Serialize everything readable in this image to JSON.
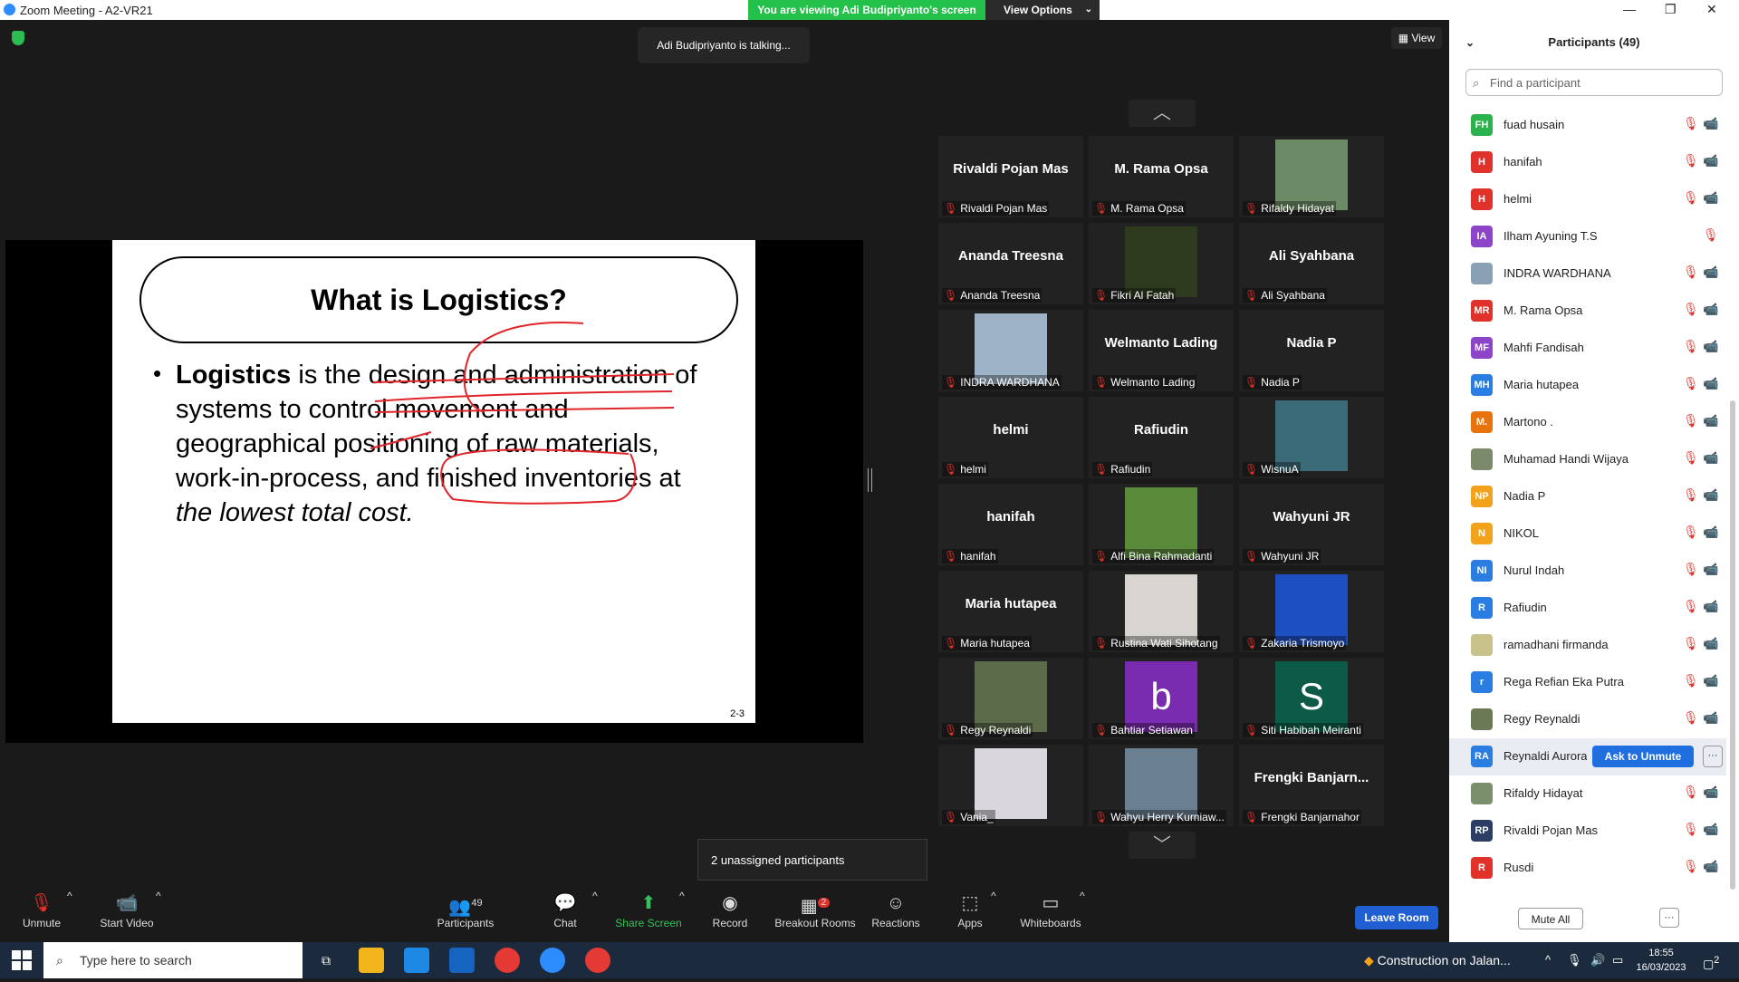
{
  "window": {
    "title": "Zoom Meeting - A2-VR21"
  },
  "banner": {
    "viewing": "You are viewing Adi Budipriyanto's screen",
    "view_options": "View Options"
  },
  "talking": "Adi Budipriyanto is talking...",
  "view_label": "View",
  "slide": {
    "title": "What is Logistics?",
    "bullet": "•",
    "text_bold": "Logistics",
    "text_1": " is the design and administration of systems to control movement and geographical positioning of raw materials, work-in-process, and finished inventories at ",
    "text_italic": "the lowest total cost.",
    "page_number": "2-3"
  },
  "gallery": [
    {
      "display": "Rivaldi Pojan Mas",
      "name": "Rivaldi Pojan Mas",
      "photo": null
    },
    {
      "display": "M. Rama Opsa",
      "name": "M. Rama Opsa",
      "photo": null
    },
    {
      "display": "",
      "name": "Rifaldy Hidayat",
      "photo": "#6d8a66"
    },
    {
      "display": "Ananda Treesna",
      "name": "Ananda Treesna",
      "photo": null
    },
    {
      "display": "",
      "name": "Fikri Al Fatah",
      "photo": "#2d3a1e"
    },
    {
      "display": "Ali Syahbana",
      "name": "Ali Syahbana",
      "photo": null
    },
    {
      "display": "",
      "name": "INDRA WARDHANA",
      "photo": "#9fb3c8"
    },
    {
      "display": "Welmanto Lading",
      "name": "Welmanto Lading",
      "photo": null
    },
    {
      "display": "Nadia P",
      "name": "Nadia P",
      "photo": null
    },
    {
      "display": "helmi",
      "name": "helmi",
      "photo": null
    },
    {
      "display": "Rafiudin",
      "name": "Rafiudin",
      "photo": null
    },
    {
      "display": "",
      "name": "WisnuA",
      "photo": "#3b6a78"
    },
    {
      "display": "hanifah",
      "name": "hanifah",
      "photo": null
    },
    {
      "display": "",
      "name": "Alfi Bina Rahmadanti",
      "photo": "#5a8b3a"
    },
    {
      "display": "Wahyuni JR",
      "name": "Wahyuni JR",
      "photo": null
    },
    {
      "display": "Maria hutapea",
      "name": "Maria hutapea",
      "photo": null
    },
    {
      "display": "",
      "name": "Rustina Wati Sihotang",
      "photo": "#d8d4cf"
    },
    {
      "display": "",
      "name": "Zakaria Trismoyo",
      "photo": "#1e4fc2"
    },
    {
      "display": "",
      "name": "Regy Reynaldi",
      "photo": "#5c6b4a"
    },
    {
      "display": "b",
      "name": "Bahtiar Setiawan",
      "photo": "#7a2cb0"
    },
    {
      "display": "S",
      "name": "Siti Habibah Meiranti",
      "photo": "#0b5b48"
    },
    {
      "display": "",
      "name": "Vania_",
      "photo": "#d9d6de"
    },
    {
      "display": "",
      "name": "Wahyu Herry Kurniaw...",
      "photo": "#6a7f8f"
    },
    {
      "display": "Frengki Banjarn...",
      "name": "Frengki Banjarnahor",
      "photo": null
    }
  ],
  "unassigned_popup": "2 unassigned participants",
  "toolbar": {
    "unmute": "Unmute",
    "start_video": "Start Video",
    "participants": "Participants",
    "participants_count": "49",
    "chat": "Chat",
    "share_screen": "Share Screen",
    "record": "Record",
    "breakout": "Breakout Rooms",
    "breakout_badge": "2",
    "reactions": "Reactions",
    "apps": "Apps",
    "whiteboards": "Whiteboards",
    "leave": "Leave Room"
  },
  "panel": {
    "title": "Participants (49)",
    "search_placeholder": "Find a participant",
    "mute_all": "Mute All",
    "ask_unmute": "Ask to Unmute",
    "participants": [
      {
        "initials": "FH",
        "name": "fuad husain",
        "color": "#2bb24c",
        "video_off": true
      },
      {
        "initials": "H",
        "name": "hanifah",
        "color": "#e0312a",
        "video_off": true
      },
      {
        "initials": "H",
        "name": "helmi",
        "color": "#e0312a",
        "video_off": true
      },
      {
        "initials": "IA",
        "name": "Ilham Ayuning T.S",
        "color": "#8e44c9",
        "video_off": false
      },
      {
        "initials": "",
        "name": "INDRA WARDHANA",
        "color": "#8aa0b5",
        "video_off": true
      },
      {
        "initials": "MR",
        "name": "M. Rama Opsa",
        "color": "#e0312a",
        "video_off": true
      },
      {
        "initials": "MF",
        "name": "Mahfi Fandisah",
        "color": "#8e44c9",
        "video_off": true
      },
      {
        "initials": "MH",
        "name": "Maria hutapea",
        "color": "#2a7de1",
        "video_off": true
      },
      {
        "initials": "M.",
        "name": "Martono .",
        "color": "#e8720c",
        "video_off": true
      },
      {
        "initials": "",
        "name": "Muhamad Handi Wijaya",
        "color": "#7a8a6a",
        "video_off": true
      },
      {
        "initials": "NP",
        "name": "Nadia P",
        "color": "#f2a31b",
        "video_off": true
      },
      {
        "initials": "N",
        "name": "NIKOL",
        "color": "#f2a31b",
        "video_off": true
      },
      {
        "initials": "NI",
        "name": "Nurul Indah",
        "color": "#2a7de1",
        "video_off": true
      },
      {
        "initials": "R",
        "name": "Rafiudin",
        "color": "#2a7de1",
        "video_off": true
      },
      {
        "initials": "",
        "name": "ramadhani firmanda",
        "color": "#c9c28a",
        "video_off": true
      },
      {
        "initials": "r",
        "name": "Rega Refian Eka Putra",
        "color": "#2a7de1",
        "video_off": true
      },
      {
        "initials": "",
        "name": "Regy Reynaldi",
        "color": "#6b7a55",
        "video_off": true
      },
      {
        "initials": "RA",
        "name": "Reynaldi Aurora",
        "color": "#2a7de1",
        "video_off": false
      },
      {
        "initials": "",
        "name": "Rifaldy Hidayat",
        "color": "#7c8f6c",
        "video_off": true
      },
      {
        "initials": "RP",
        "name": "Rivaldi Pojan Mas",
        "color": "#2c3e66",
        "video_off": true
      },
      {
        "initials": "R",
        "name": "Rusdi",
        "color": "#e0312a",
        "video_off": true
      }
    ]
  },
  "taskbar": {
    "search_placeholder": "Type here to search",
    "weather": "Construction on Jalan...",
    "time": "18:55",
    "date": "16/03/2023",
    "notifications": "2"
  }
}
